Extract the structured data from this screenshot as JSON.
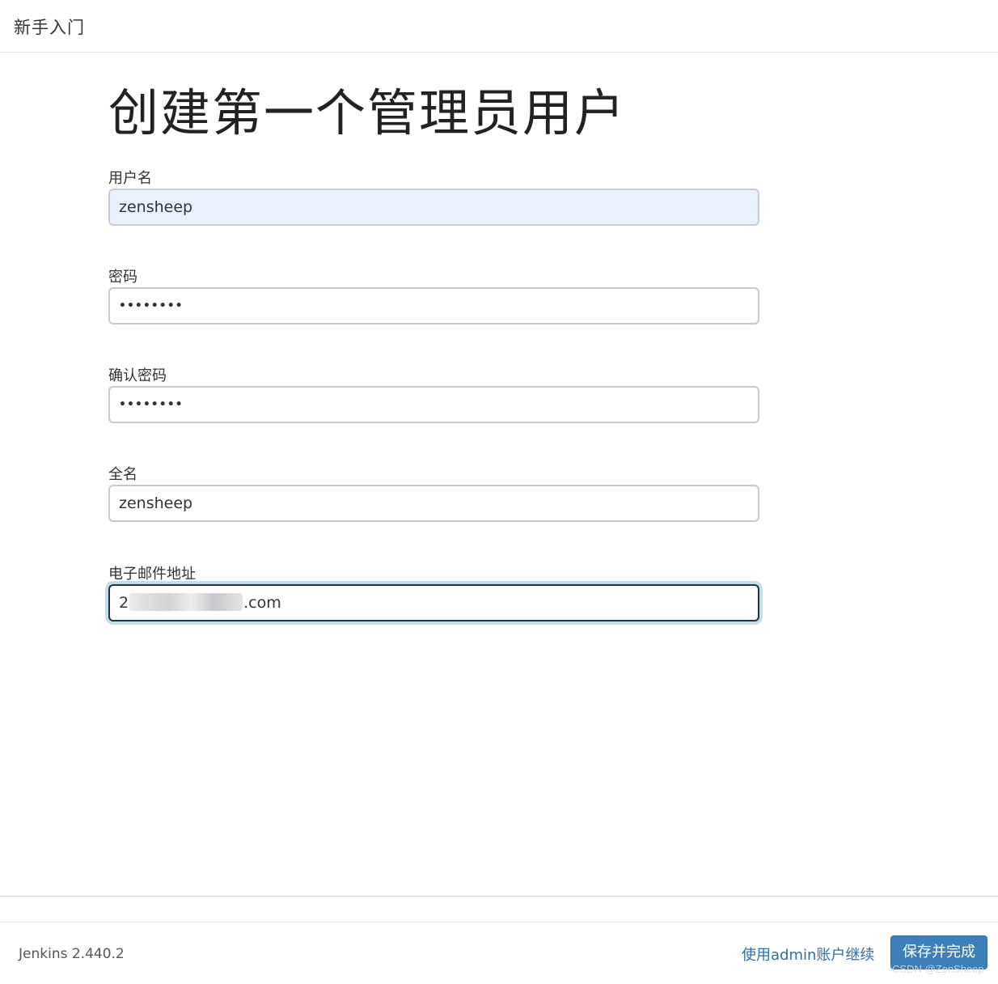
{
  "header": {
    "title": "新手入门"
  },
  "main": {
    "heading": "创建第一个管理员用户",
    "fields": {
      "username": {
        "label": "用户名",
        "value": "zensheep"
      },
      "password": {
        "label": "密码",
        "value": "••••••••"
      },
      "confirm_password": {
        "label": "确认密码",
        "value": "••••••••"
      },
      "full_name": {
        "label": "全名",
        "value": "zensheep"
      },
      "email": {
        "label": "电子邮件地址",
        "value_prefix": "2",
        "value_suffix": ".com"
      }
    }
  },
  "footer": {
    "version": "Jenkins 2.440.2",
    "admin_link": "使用admin账户继续",
    "save_button": "保存并完成"
  },
  "watermark": "CSDN @ZenSheep",
  "colors": {
    "primary_button": "#3d7fb9",
    "link": "#2f6ea9",
    "autofill_bg": "#e8f0fe",
    "focus_ring": "#c5dceb"
  }
}
